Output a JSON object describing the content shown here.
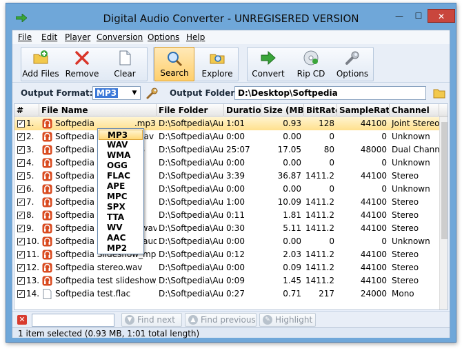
{
  "window": {
    "title": "Digital Audio Converter - UNREGISERED VERSION",
    "minimize_glyph": "—",
    "maximize_glyph": "☐",
    "close_glyph": "✕"
  },
  "menu": [
    "File",
    "Edit",
    "Player",
    "Conversion",
    "Options",
    "Help"
  ],
  "toolbar": {
    "add_files": "Add Files",
    "remove": "Remove",
    "clear": "Clear",
    "search": "Search",
    "explore": "Explore",
    "convert": "Convert",
    "rip_cd": "Rip CD",
    "options": "Options",
    "active": "Search"
  },
  "output": {
    "format_label": "Output Format:",
    "format_value": "MP3",
    "folder_label": "Output Folder:",
    "folder_value": "D:\\Desktop\\Softpedia"
  },
  "format_options": [
    "MP3",
    "WAV",
    "WMA",
    "OGG",
    "FLAC",
    "APE",
    "MPC",
    "SPX",
    "TTA",
    "WV",
    "AAC",
    "MP2"
  ],
  "table": {
    "headers": [
      "#",
      "File Name",
      "File Folder",
      "Duration",
      "Size (MB)",
      "BitRate",
      "SampleRate",
      "Channel"
    ],
    "rows": [
      {
        "n": "1.",
        "name": "Softpedia",
        "tail": ".mp3",
        "folder": "D:\\Softpedia\\Aud",
        "dur": "1:01",
        "size": "0.93",
        "bitrate": "128",
        "sr": "44100",
        "ch": "Joint Stereo",
        "checked": true,
        "selected": true,
        "icon": "audio"
      },
      {
        "n": "2.",
        "name": "Softpedia",
        "tail": ".wav",
        "folder": "D:\\Softpedia\\Aud",
        "dur": "0:00",
        "size": "0.00",
        "bitrate": "0",
        "sr": "0",
        "ch": "Unknown",
        "checked": true,
        "selected": false,
        "icon": "audio"
      },
      {
        "n": "3.",
        "name": "Softpedia",
        "tail": "p3",
        "folder": "D:\\Softpedia\\Aud",
        "dur": "25:07",
        "size": "17.05",
        "bitrate": "80",
        "sr": "48000",
        "ch": "Dual Channel",
        "checked": true,
        "selected": false,
        "icon": "audio"
      },
      {
        "n": "4.",
        "name": "Softpedia",
        "tail": "",
        "folder": "D:\\Softpedia\\Aud",
        "dur": "0:00",
        "size": "0.00",
        "bitrate": "0",
        "sr": "0",
        "ch": "Unknown",
        "checked": true,
        "selected": false,
        "icon": "audio"
      },
      {
        "n": "5.",
        "name": "Softpedia",
        "tail": "",
        "folder": "D:\\Softpedia\\Aud",
        "dur": "3:39",
        "size": "36.87",
        "bitrate": "1411.2",
        "sr": "44100",
        "ch": "Stereo",
        "checked": true,
        "selected": false,
        "icon": "audio"
      },
      {
        "n": "6.",
        "name": "Softpedia",
        "tail": "",
        "folder": "D:\\Softpedia\\Aud",
        "dur": "0:00",
        "size": "0.00",
        "bitrate": "0",
        "sr": "0",
        "ch": "Unknown",
        "checked": true,
        "selected": false,
        "icon": "audio"
      },
      {
        "n": "7.",
        "name": "Softpedia",
        "tail": "",
        "folder": "D:\\Softpedia\\Aud",
        "dur": "1:00",
        "size": "10.09",
        "bitrate": "1411.2",
        "sr": "44100",
        "ch": "Stereo",
        "checked": true,
        "selected": false,
        "icon": "audio"
      },
      {
        "n": "8.",
        "name": "Softpedia",
        "tail": "",
        "folder": "D:\\Softpedia\\Aud",
        "dur": "0:11",
        "size": "1.81",
        "bitrate": "1411.2",
        "sr": "44100",
        "ch": "Stereo",
        "checked": true,
        "selected": false,
        "icon": "audio"
      },
      {
        "n": "9.",
        "name": "Softpedia",
        "tail": " Recording.wav",
        "folder": "D:\\Softpedia\\Aud",
        "dur": "0:30",
        "size": "5.11",
        "bitrate": "1411.2",
        "sr": "44100",
        "ch": "Stereo",
        "checked": true,
        "selected": false,
        "icon": "audio"
      },
      {
        "n": "10.",
        "name": "Softpedia",
        "tail": " Slideshow_audio",
        "folder": "D:\\Softpedia\\Aud",
        "dur": "0:00",
        "size": "0.00",
        "bitrate": "0",
        "sr": "0",
        "ch": "Unknown",
        "checked": true,
        "selected": false,
        "icon": "audio"
      },
      {
        "n": "11.",
        "name": "Softpedia",
        "tail": " Slideshow_mp4.",
        "folder": "D:\\Softpedia\\Aud",
        "dur": "0:12",
        "size": "2.03",
        "bitrate": "1411.2",
        "sr": "44100",
        "ch": "Stereo",
        "checked": true,
        "selected": false,
        "icon": "audio"
      },
      {
        "n": "12.",
        "name": "Softpedia",
        "tail": " stereo.wav",
        "folder": "D:\\Softpedia\\Aud",
        "dur": "0:00",
        "size": "0.09",
        "bitrate": "1411.2",
        "sr": "44100",
        "ch": "Stereo",
        "checked": true,
        "selected": false,
        "icon": "audio"
      },
      {
        "n": "13.",
        "name": "Softpedia",
        "tail": " test slideshow_av",
        "folder": "D:\\Softpedia\\Aud",
        "dur": "0:09",
        "size": "1.45",
        "bitrate": "1411.2",
        "sr": "44100",
        "ch": "Stereo",
        "checked": true,
        "selected": false,
        "icon": "audio"
      },
      {
        "n": "14.",
        "name": "Softpedia",
        "tail": " test.flac",
        "folder": "D:\\Softpedia\\Aud",
        "dur": "0:27",
        "size": "0.71",
        "bitrate": "217",
        "sr": "24000",
        "ch": "Mono",
        "checked": true,
        "selected": false,
        "icon": "doc"
      }
    ]
  },
  "findbar": {
    "find_next": "Find next",
    "find_previous": "Find previous",
    "highlight": "Highlight"
  },
  "status": "1 item selected (0.93 MB, 1:01 total length)",
  "colors": {
    "frame": "#6fa7d9",
    "selection": "#ffe08d",
    "close_button": "#c9463d",
    "audio_icon": "#d94b20"
  }
}
